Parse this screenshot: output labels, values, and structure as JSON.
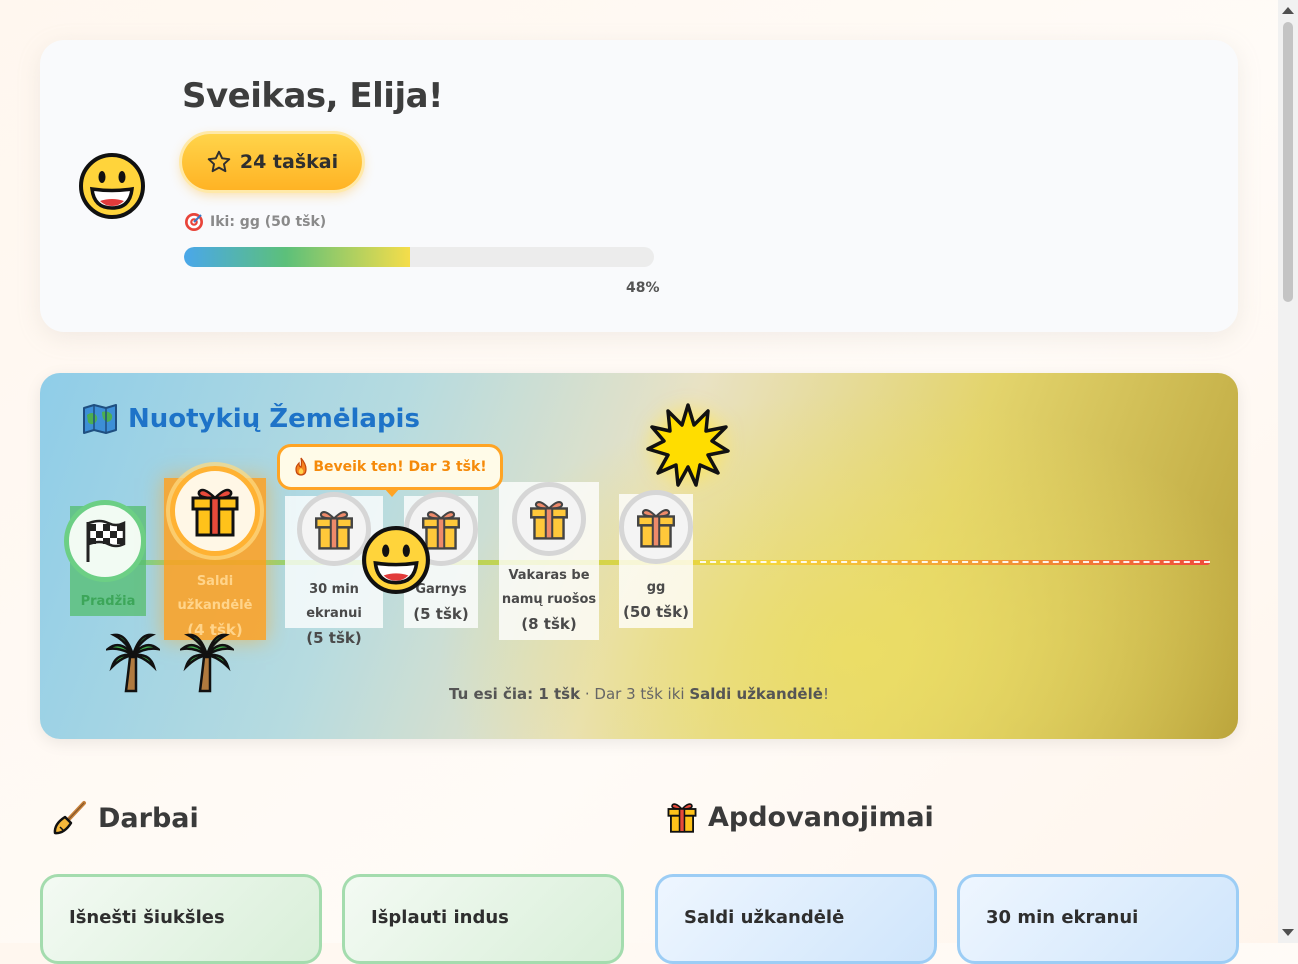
{
  "header": {
    "greeting": "Sveikas, Elija!",
    "points_label": "24 taškai",
    "goal_text": "Iki: gg (50 tšk)",
    "progress_fraction": 0.48,
    "progress_label": "48%"
  },
  "map": {
    "title": "Nuotykių Žemėlapis",
    "tooltip": "Beveik ten! Dar 3 tšk!",
    "nodes": [
      {
        "label": "Pradžia",
        "cost": ""
      },
      {
        "label": "Saldi užkandėlė",
        "cost": "(4 tšk)"
      },
      {
        "label": "30 min ekranui",
        "cost": "(5 tšk)"
      },
      {
        "label": "Garnys",
        "cost": "(5 tšk)"
      },
      {
        "label": "Vakaras be namų ruošos",
        "cost": "(8 tšk)"
      },
      {
        "label": "gg",
        "cost": "(50 tšk)"
      }
    ],
    "status": {
      "you_are_here": "Tu esi čia: 1 tšk",
      "separator": " · ",
      "remaining_prefix": "Dar 3 tšk iki ",
      "target": "Saldi užkandėlė",
      "suffix": "!"
    }
  },
  "sections": {
    "chores_title": "Darbai",
    "rewards_title": "Apdovanojimai"
  },
  "chores": [
    {
      "title": "Išnešti šiukšles"
    },
    {
      "title": "Išplauti indus"
    }
  ],
  "rewards": [
    {
      "title": "Saldi užkandėlė"
    },
    {
      "title": "30 min ekranui"
    }
  ],
  "colors": {
    "accent_gold": "#ffb324",
    "map_title_blue": "#1e73c8",
    "chore_border": "#a4dcae",
    "reward_border": "#9ccdf5"
  }
}
